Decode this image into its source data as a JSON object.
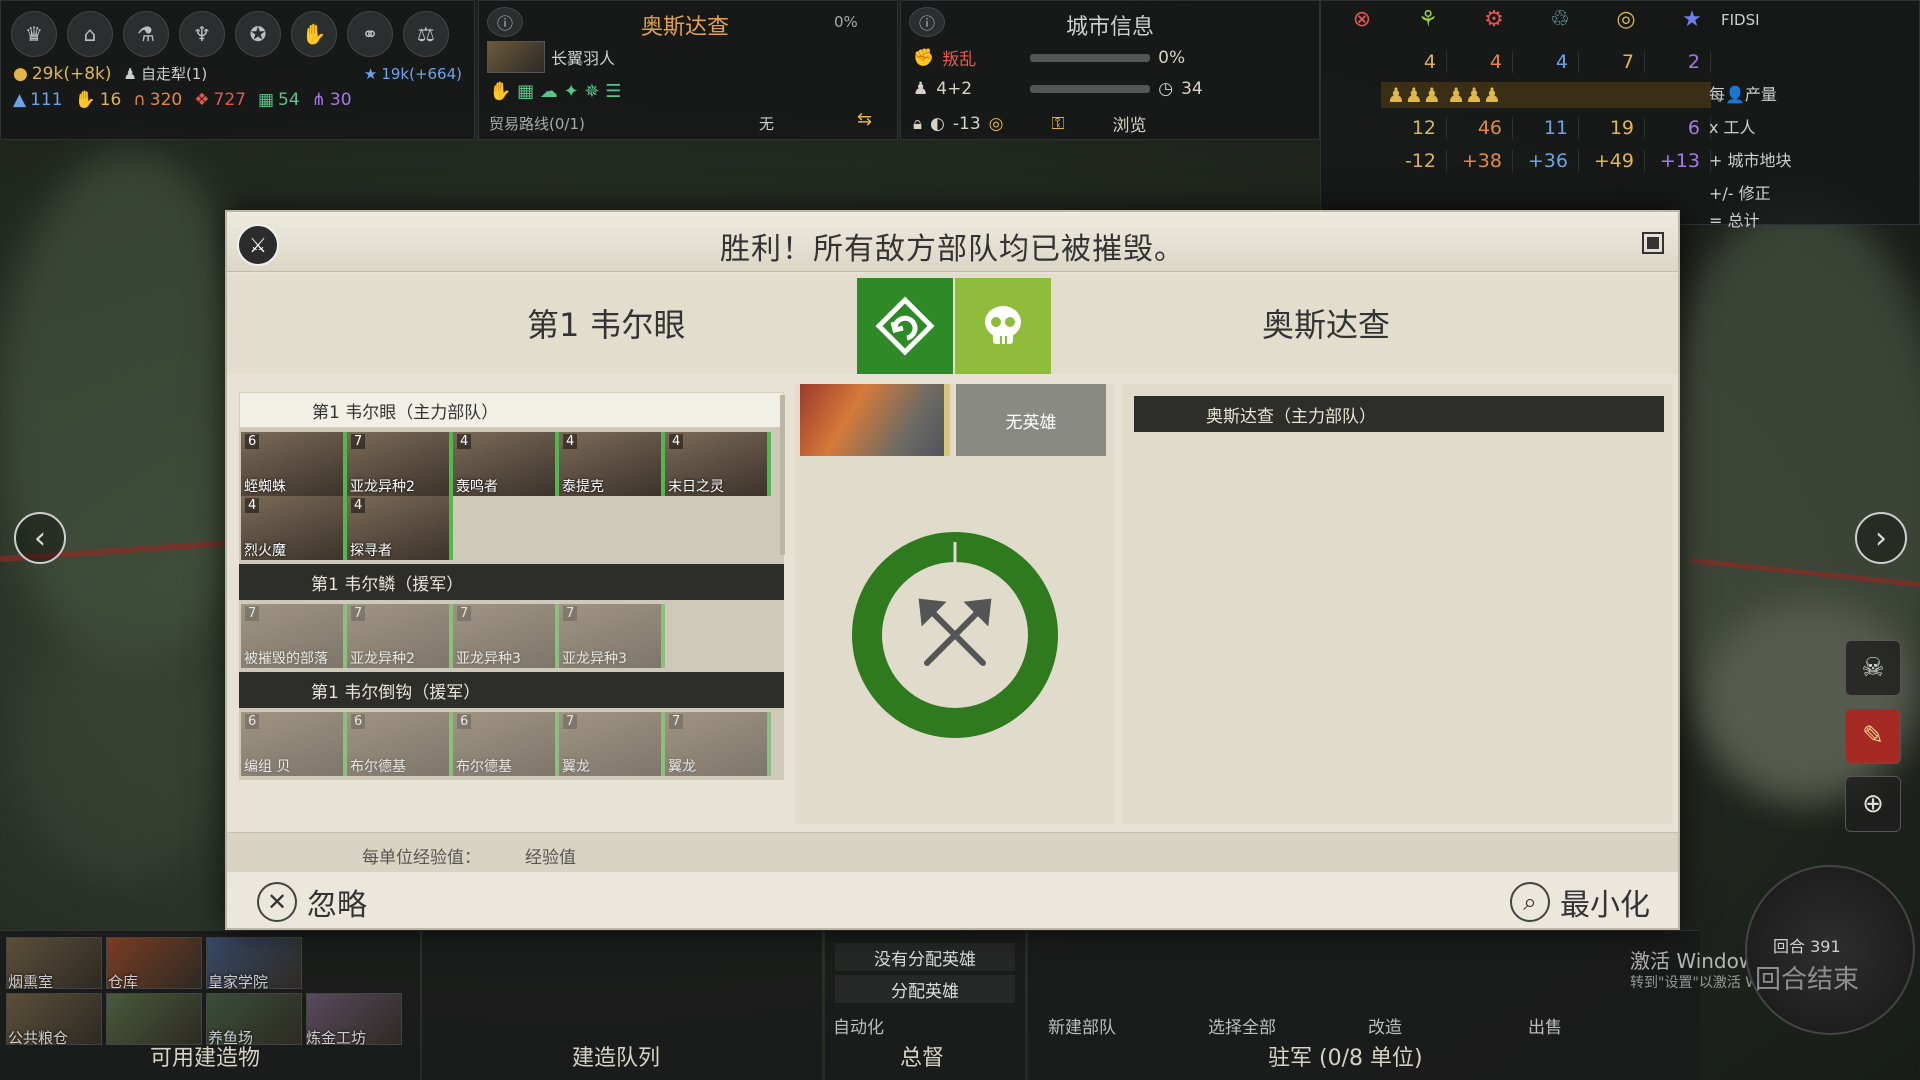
{
  "hud_left": {
    "gold": "29k(+8k)",
    "auto": "自走犁(1)",
    "research": "19k(+664)",
    "stats": [
      "111",
      "16",
      "320",
      "727",
      "54",
      "30"
    ]
  },
  "hud_mid": {
    "title": "奥斯达查",
    "percent": "0%",
    "unit": "长翼羽人",
    "trade_route": "贸易路线(0/1)",
    "trade_value": "无"
  },
  "hud_city": {
    "title": "城市信息",
    "rebellion_label": "叛乱",
    "rebellion_pct": "0%",
    "pop": "4+2",
    "growth_turns": "34",
    "happiness": "-13",
    "browse": "浏览"
  },
  "hud_right": {
    "fidsi": "FIDSI",
    "rows": [
      {
        "values": [
          "4",
          "4",
          "4",
          "7",
          "2"
        ],
        "label": "每👤产量"
      },
      {
        "values": [
          "",
          "",
          "",
          "",
          ""
        ],
        "label": "x 工人"
      },
      {
        "values": [
          "12",
          "46",
          "11",
          "19",
          "6"
        ],
        "label": "+ 城市地块"
      },
      {
        "values": [
          "-12",
          "+38",
          "+36",
          "+49",
          "+13"
        ],
        "label": "+/- 修正"
      },
      {
        "values": [
          "",
          "",
          "",
          "",
          ""
        ],
        "label": "= 总计"
      }
    ]
  },
  "dialog": {
    "title": "胜利！所有敌方部队均已被摧毁。",
    "left_side": "第1 韦尔眼",
    "right_side": "奥斯达查",
    "no_hero": "无英雄",
    "right_army_head": "奥斯达查（主力部队）",
    "armies": [
      {
        "name": "第1 韦尔眼（主力部队）",
        "style": "main",
        "units": [
          {
            "lvl": "6",
            "name": "蛭蜘蛛"
          },
          {
            "lvl": "7",
            "name": "亚龙异种2"
          },
          {
            "lvl": "4",
            "name": "轰鸣者"
          },
          {
            "lvl": "4",
            "name": "泰提克"
          },
          {
            "lvl": "4",
            "name": "末日之灵"
          },
          {
            "lvl": "4",
            "name": "烈火魔"
          },
          {
            "lvl": "4",
            "name": "探寻者"
          }
        ]
      },
      {
        "name": "第1 韦尔鳞（援军）",
        "style": "dark",
        "units": [
          {
            "lvl": "7",
            "name": "被摧毁的部落"
          },
          {
            "lvl": "7",
            "name": "亚龙异种2"
          },
          {
            "lvl": "7",
            "name": "亚龙异种3"
          },
          {
            "lvl": "7",
            "name": "亚龙异种3"
          }
        ]
      },
      {
        "name": "第1 韦尔倒钩（援军）",
        "style": "dark",
        "units": [
          {
            "lvl": "6",
            "name": "编组 贝"
          },
          {
            "lvl": "6",
            "name": "布尔德基"
          },
          {
            "lvl": "6",
            "name": "布尔德基"
          },
          {
            "lvl": "7",
            "name": "翼龙"
          },
          {
            "lvl": "7",
            "name": "翼龙"
          }
        ]
      }
    ],
    "xp_label": "每单位经验值：",
    "xp_value": "经验值",
    "ignore": "忽略",
    "minimize": "最小化"
  },
  "bottom": {
    "buildings": [
      "烟熏室",
      "仓库",
      "皇家学院",
      "公共粮仓",
      "养鱼场",
      "炼金工坊"
    ],
    "available_buildings": "可用建造物",
    "build_queue": "建造队列",
    "no_hero": "没有分配英雄",
    "assign_hero": "分配英雄",
    "automate": "自动化",
    "governor": "总督",
    "new_army": "新建部队",
    "select_all": "选择全部",
    "refit": "改造",
    "sell": "出售",
    "garrison": "驻军 (0/8 单位)",
    "turn": "回合 391",
    "end_turn": "回合结束",
    "win_activate": "激活 Windows",
    "win_activate_sub": "转到\"设置\"以激活 Windows。"
  },
  "colors": {
    "victory_green": "#2e8a26",
    "skull_green": "#8fbc3a",
    "ring_green": "#2f7a1f"
  }
}
